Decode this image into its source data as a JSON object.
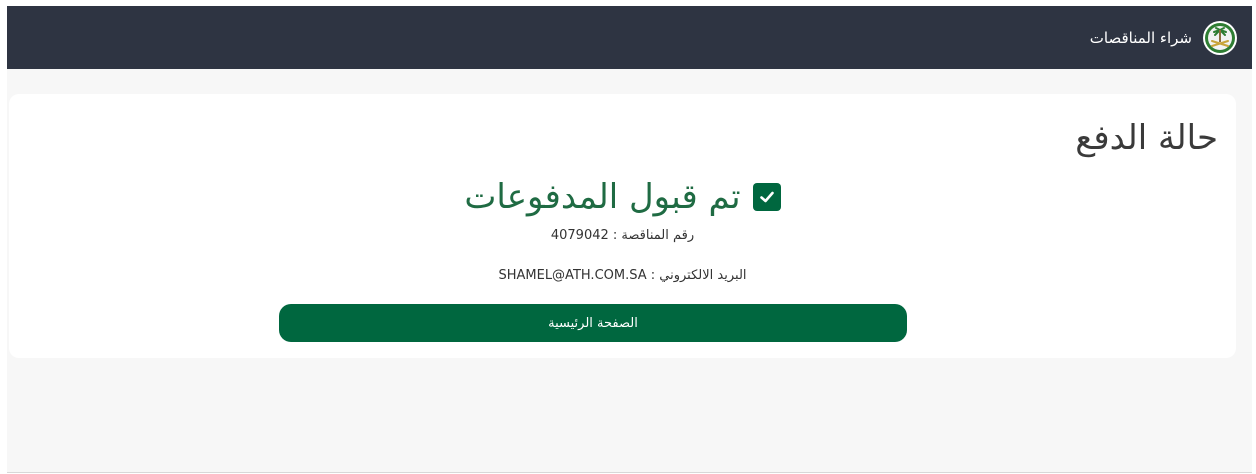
{
  "navbar": {
    "brand_name": "شراء المناقصات",
    "logo_icon": "palm-swords-emblem-icon"
  },
  "page": {
    "title": "حالة الدفع"
  },
  "status": {
    "icon": "checkbox-checked-icon",
    "message": "تم قبول المدفوعات"
  },
  "details": {
    "tender_label": "رقم المناقصة :",
    "tender_number": "4079042",
    "email_label": "البريد الالكتروني :",
    "email": "SHAMEL@ATH.COM.SA"
  },
  "actions": {
    "home_label": "الصفحة الرئيسية"
  },
  "colors": {
    "navbar_bg": "#2e3442",
    "accent_green": "#00673f",
    "status_text": "#1f6b43",
    "page_bg": "#f7f7f7"
  }
}
